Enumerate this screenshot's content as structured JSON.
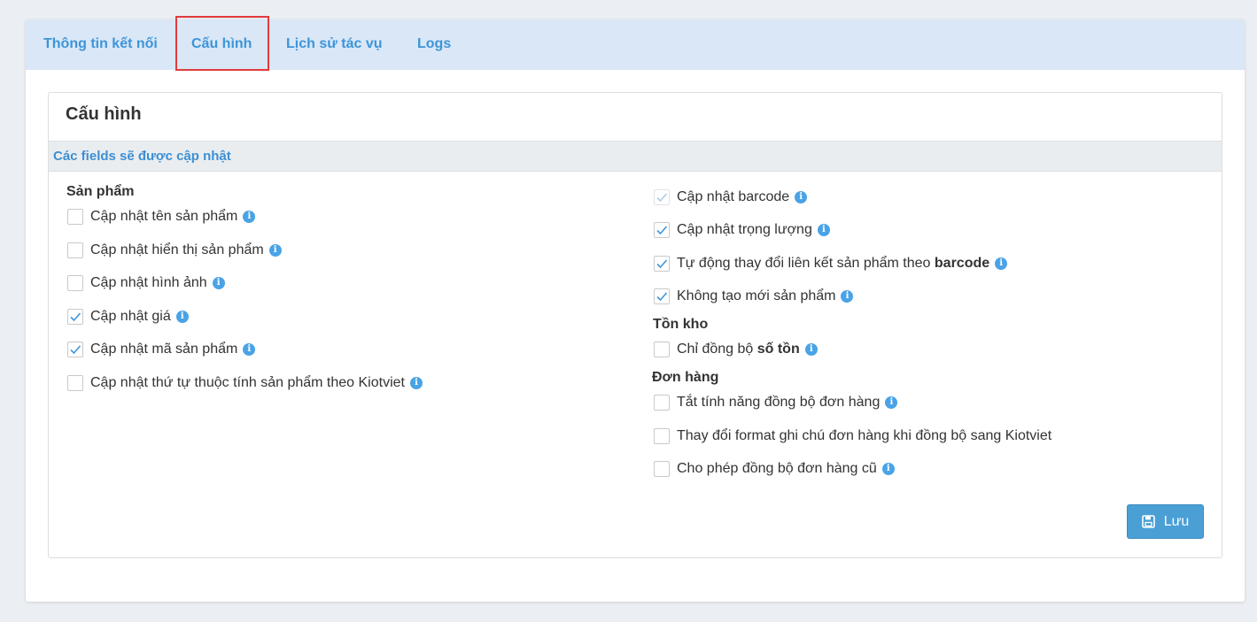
{
  "tabs": [
    {
      "label": "Thông tin kết nối"
    },
    {
      "label": "Cấu hình"
    },
    {
      "label": "Lịch sử tác vụ"
    },
    {
      "label": "Logs"
    }
  ],
  "panel": {
    "title": "Cấu hình",
    "section_header": "Các fields sẽ được cập nhật"
  },
  "groups": {
    "san_pham": "Sản phẩm",
    "ton_kho": "Tồn kho",
    "don_hang": "Đơn hàng"
  },
  "left_options": [
    {
      "label": "Cập nhật tên sản phẩm",
      "checked": false,
      "info": true
    },
    {
      "label": "Cập nhật hiển thị sản phẩm",
      "checked": false,
      "info": true
    },
    {
      "label": "Cập nhật hình ảnh",
      "checked": false,
      "info": true
    },
    {
      "label": "Cập nhật giá",
      "checked": true,
      "info": true
    },
    {
      "label": "Cập nhật mã sản phẩm",
      "checked": true,
      "info": true
    },
    {
      "label": "Cập nhật thứ tự thuộc tính sản phẩm theo Kiotviet",
      "checked": false,
      "info": true
    }
  ],
  "right_options": [
    {
      "label": "Cập nhật barcode",
      "checked": true,
      "disabled": true,
      "info": true
    },
    {
      "label": "Cập nhật trọng lượng",
      "checked": true,
      "info": true
    },
    {
      "label_prefix": "Tự động thay đổi liên kết sản phẩm theo ",
      "label_bold": "barcode",
      "checked": true,
      "info": true
    },
    {
      "label": "Không tạo mới sản phẩm",
      "checked": true,
      "info": true
    }
  ],
  "stock_options": [
    {
      "label_prefix": "Chỉ đồng bộ ",
      "label_bold": "số tồn",
      "checked": false,
      "info": true
    }
  ],
  "order_options": [
    {
      "label": "Tắt tính năng đồng bộ đơn hàng",
      "checked": false,
      "info": true
    },
    {
      "label": "Thay đổi format ghi chú đơn hàng khi đồng bộ sang Kiotviet",
      "checked": false,
      "info": false
    },
    {
      "label": "Cho phép đồng bộ đơn hàng cũ",
      "checked": false,
      "info": true
    }
  ],
  "info_glyph": "i",
  "save_button": {
    "label": "Lưu",
    "icon": "floppy-disk-icon"
  },
  "colors": {
    "accent": "#3c95d9",
    "tabbar": "#dae7f6",
    "highlight": "#e03c3c",
    "button": "#4a9fd5"
  }
}
